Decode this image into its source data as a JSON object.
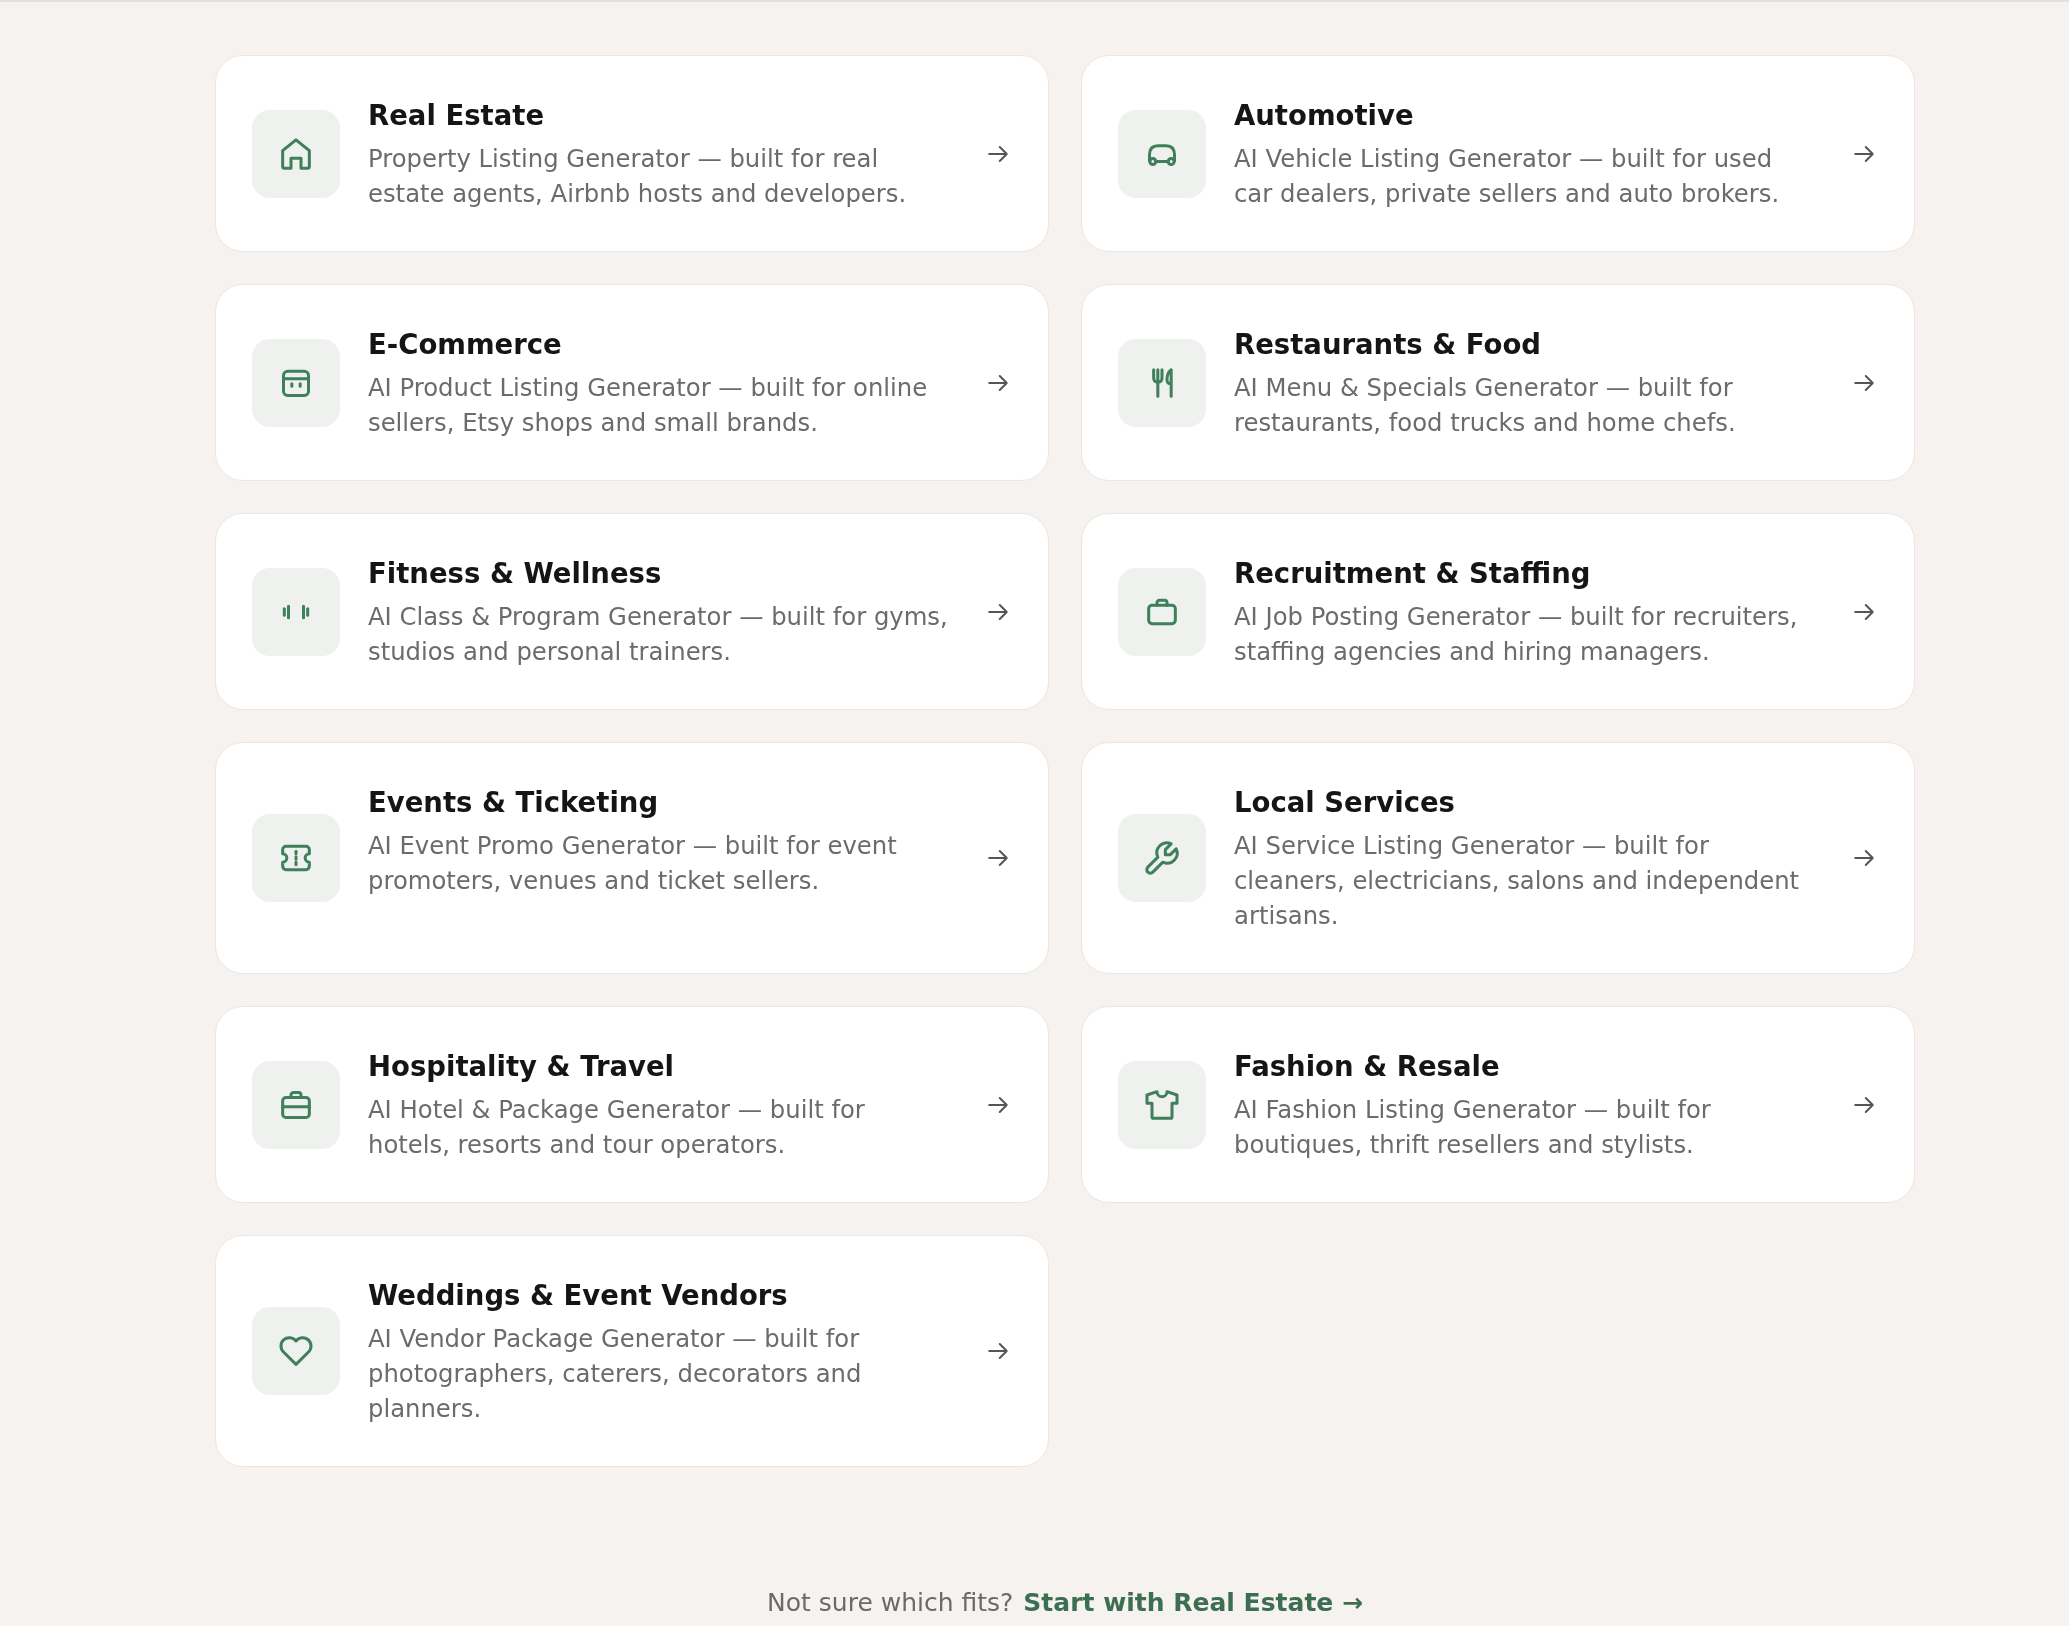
{
  "cards": [
    {
      "title": "Real Estate",
      "description": "Property Listing Generator — built for real estate agents, Airbnb hosts and developers."
    },
    {
      "title": "Automotive",
      "description": "AI Vehicle Listing Generator — built for used car dealers, private sellers and auto brokers."
    },
    {
      "title": "E-Commerce",
      "description": "AI Product Listing Generator — built for online sellers, Etsy shops and small brands."
    },
    {
      "title": "Restaurants & Food",
      "description": "AI Menu & Specials Generator — built for restaurants, food trucks and home chefs."
    },
    {
      "title": "Fitness & Wellness",
      "description": "AI Class & Program Generator — built for gyms, studios and personal trainers."
    },
    {
      "title": "Recruitment & Staffing",
      "description": "AI Job Posting Generator — built for recruiters, staffing agencies and hiring managers."
    },
    {
      "title": "Events & Ticketing",
      "description": "AI Event Promo Generator — built for event promoters, venues and ticket sellers."
    },
    {
      "title": "Local Services",
      "description": "AI Service Listing Generator — built for cleaners, electricians, salons and independent artisans."
    },
    {
      "title": "Hospitality & Travel",
      "description": "AI Hotel & Package Generator — built for hotels, resorts and tour operators."
    },
    {
      "title": "Fashion & Resale",
      "description": "AI Fashion Listing Generator — built for boutiques, thrift resellers and stylists."
    },
    {
      "title": "Weddings & Event Vendors",
      "description": "AI Vendor Package Generator — built for photographers, caterers, decorators and planners."
    }
  ],
  "footer": {
    "text": "Not sure which fits?",
    "link": "Start with Real Estate →"
  }
}
